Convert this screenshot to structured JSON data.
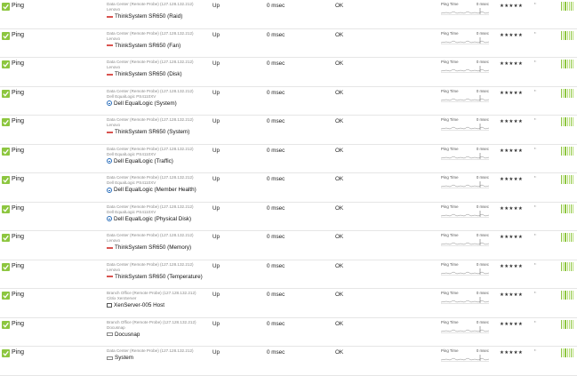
{
  "rows": [
    {
      "sensor": "Ping",
      "probe": "Data Center (Remote Probe) (127.128.132.212)",
      "group": "Lenovo",
      "device": "ThinkSystem SR650 (Raid)",
      "icon": "server-icon",
      "status": "Up",
      "value": "0 msec",
      "message": "OK",
      "chart_label": "Ping Time",
      "chart_value": "0 msec",
      "stars": "★★★★★"
    },
    {
      "sensor": "Ping",
      "probe": "Data Center (Remote Probe) (127.128.132.212)",
      "group": "Lenovo",
      "device": "ThinkSystem SR650 (Fan)",
      "icon": "server-icon",
      "status": "Up",
      "value": "0 msec",
      "message": "OK",
      "chart_label": "Ping Time",
      "chart_value": "0 msec",
      "stars": "★★★★★"
    },
    {
      "sensor": "Ping",
      "probe": "Data Center (Remote Probe) (127.128.132.212)",
      "group": "Lenovo",
      "device": "ThinkSystem SR650 (Disk)",
      "icon": "server-icon",
      "status": "Up",
      "value": "0 msec",
      "message": "OK",
      "chart_label": "Ping Time",
      "chart_value": "0 msec",
      "stars": "★★★★★"
    },
    {
      "sensor": "Ping",
      "probe": "Data Center (Remote Probe) (127.128.132.212)",
      "group": "Dell EqualLogic PS4110XV",
      "device": "Dell EqualLogic (System)",
      "icon": "storage-icon",
      "status": "Up",
      "value": "0 msec",
      "message": "OK",
      "chart_label": "Ping Time",
      "chart_value": "0 msec",
      "stars": "★★★★★"
    },
    {
      "sensor": "Ping",
      "probe": "Data Center (Remote Probe) (127.128.132.212)",
      "group": "Lenovo",
      "device": "ThinkSystem SR650 (System)",
      "icon": "server-icon",
      "status": "Up",
      "value": "0 msec",
      "message": "OK",
      "chart_label": "Ping Time",
      "chart_value": "0 msec",
      "stars": "★★★★★"
    },
    {
      "sensor": "Ping",
      "probe": "Data Center (Remote Probe) (127.128.132.212)",
      "group": "Dell EqualLogic PS4110XV",
      "device": "Dell EqualLogic (Traffic)",
      "icon": "storage-icon",
      "status": "Up",
      "value": "0 msec",
      "message": "OK",
      "chart_label": "Ping Time",
      "chart_value": "0 msec",
      "stars": "★★★★★"
    },
    {
      "sensor": "Ping",
      "probe": "Data Center (Remote Probe) (127.128.132.212)",
      "group": "Dell EqualLogic PS4110XV",
      "device": "Dell EqualLogic (Member Health)",
      "icon": "storage-icon",
      "status": "Up",
      "value": "0 msec",
      "message": "OK",
      "chart_label": "Ping Time",
      "chart_value": "0 msec",
      "stars": "★★★★★"
    },
    {
      "sensor": "Ping",
      "probe": "Data Center (Remote Probe) (127.128.132.212)",
      "group": "Dell EqualLogic PS4110XV",
      "device": "Dell EqualLogic (Physical Disk)",
      "icon": "storage-icon",
      "status": "Up",
      "value": "0 msec",
      "message": "OK",
      "chart_label": "Ping Time",
      "chart_value": "0 msec",
      "stars": "★★★★★"
    },
    {
      "sensor": "Ping",
      "probe": "Data Center (Remote Probe) (127.128.132.212)",
      "group": "Lenovo",
      "device": "ThinkSystem SR650 (Memory)",
      "icon": "server-icon",
      "status": "Up",
      "value": "0 msec",
      "message": "OK",
      "chart_label": "Ping Time",
      "chart_value": "0 msec",
      "stars": "★★★★★"
    },
    {
      "sensor": "Ping",
      "probe": "Data Center (Remote Probe) (127.128.132.212)",
      "group": "Lenovo",
      "device": "ThinkSystem SR650 (Temperature)",
      "icon": "server-icon",
      "status": "Up",
      "value": "0 msec",
      "message": "OK",
      "chart_label": "Ping Time",
      "chart_value": "0 msec",
      "stars": "★★★★★"
    },
    {
      "sensor": "Ping",
      "probe": "Branch Office (Remote Probe) (127.128.132.212)",
      "group": "Citrix XenServer",
      "device": "XenServer-005 Host",
      "icon": "vm-host-icon",
      "status": "Up",
      "value": "0 msec",
      "message": "OK",
      "chart_label": "Ping Time",
      "chart_value": "0 msec",
      "stars": "★★★★★"
    },
    {
      "sensor": "Ping",
      "probe": "Branch Office (Remote Probe) (127.128.132.212)",
      "group": "Docusnap",
      "device": "Docusnap",
      "icon": "app-icon",
      "status": "Up",
      "value": "0 msec",
      "message": "OK",
      "chart_label": "Ping Time",
      "chart_value": "0 msec",
      "stars": "★★★★★"
    },
    {
      "sensor": "Ping",
      "probe": "Data Center (Remote Probe) (127.128.132.212)",
      "group": "",
      "device": "System",
      "icon": "app-icon",
      "status": "Up",
      "value": "0 msec",
      "message": "OK",
      "chart_label": "Ping Time",
      "chart_value": "0 msec",
      "stars": "★★★★★"
    }
  ],
  "colors": {
    "ok_green": "#8dc63f",
    "down_red": "#d9534f",
    "link_blue": "#2a6ebb"
  }
}
